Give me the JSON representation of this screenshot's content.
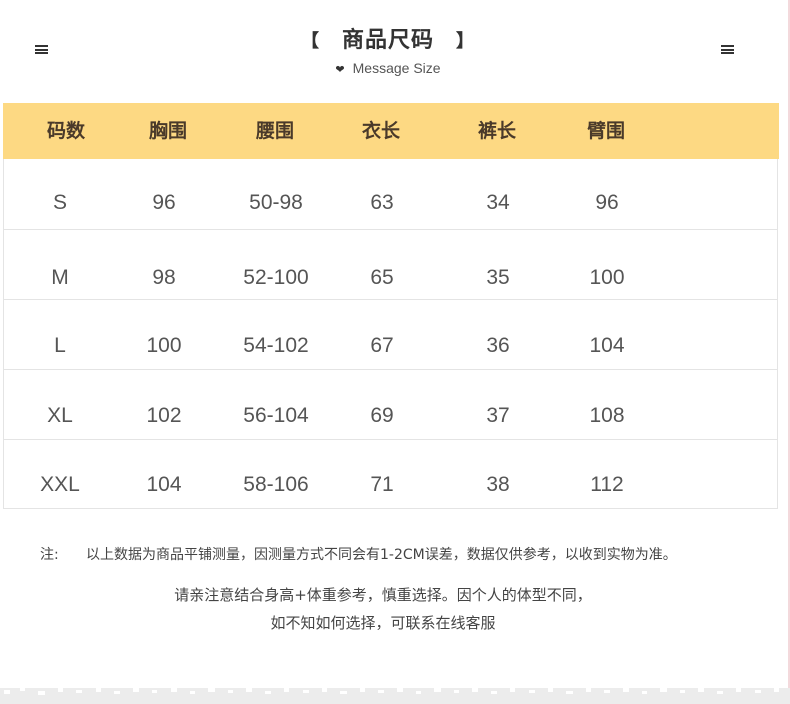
{
  "header": {
    "bracket_left": "【",
    "title": "商品尺码",
    "bracket_right": "】",
    "subtitle": "Message Size"
  },
  "icons": {
    "left_menu": "hamburger-icon",
    "right_menu": "hamburger-icon",
    "subtitle_heart": "heart-icon"
  },
  "colors": {
    "header_bg": "#fdd983",
    "border": "#e4e4e4",
    "text": "#555555"
  },
  "table": {
    "columns": [
      "码数",
      "胸围",
      "腰围",
      "衣长",
      "裤长",
      "臂围"
    ],
    "rows": [
      [
        "S",
        "96",
        "50-98",
        "63",
        "34",
        "96"
      ],
      [
        "M",
        "98",
        "52-100",
        "65",
        "35",
        "100"
      ],
      [
        "L",
        "100",
        "54-102",
        "67",
        "36",
        "104"
      ],
      [
        "XL",
        "102",
        "56-104",
        "69",
        "37",
        "108"
      ],
      [
        "XXL",
        "104",
        "58-106",
        "71",
        "38",
        "112"
      ]
    ]
  },
  "note": {
    "label": "注:",
    "text": "以上数据为商品平铺测量，因测量方式不同会有1-2CM误差，数据仅供参考，以收到实物为准。"
  },
  "tips": {
    "line1": "请亲注意结合身高+体重参考，慎重选择。因个人的体型不同，",
    "line2": "如不知如何选择，可联系在线客服"
  }
}
